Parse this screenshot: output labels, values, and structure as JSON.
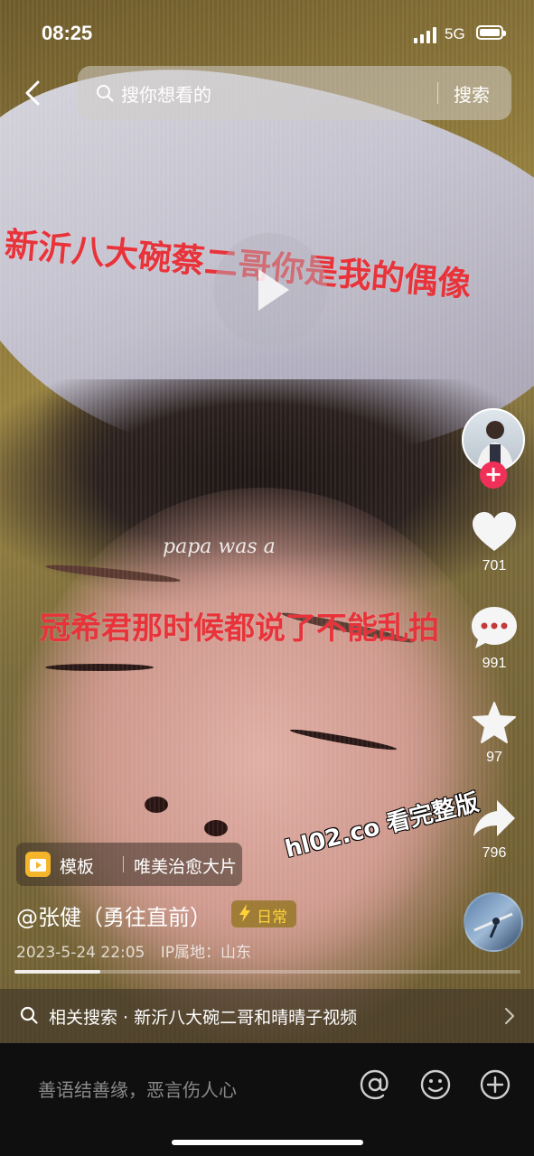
{
  "status_bar": {
    "time": "08:25",
    "network": "5G",
    "icons": [
      "signal-bars-icon",
      "battery-icon"
    ]
  },
  "header": {
    "back_icon": "chevron-left-icon",
    "search_placeholder": "搜你想看的",
    "search_button": "搜索"
  },
  "video": {
    "captions": [
      "新沂八大碗蔡二哥你是我的偶像",
      "冠希君那时候都说了不能乱拍"
    ],
    "watermark_text": "papa was a",
    "site_watermark": "hl02.co 看完整版",
    "play_icon": "play-icon"
  },
  "actions": {
    "like_count": "701",
    "comment_count": "991",
    "favorite_count": "97",
    "share_count": "796",
    "icons": [
      "heart-icon",
      "comment-bubble-icon",
      "star-icon",
      "share-arrow-icon"
    ],
    "follow_label": "+"
  },
  "post": {
    "template_label": "模板",
    "template_name": "唯美治愈大片",
    "author": "@张健（勇往直前）",
    "daily_badge": "日常",
    "date": "2023-5-24 22:05",
    "ip_location": "IP属地：山东",
    "progress_percent": 17
  },
  "related_search": {
    "text": "相关搜索 · 新沂八大碗二哥和晴晴子视频"
  },
  "comment_bar": {
    "placeholder": "善语结善缘，恶言伤人心",
    "icons": [
      "at-icon",
      "emoji-icon",
      "add-icon"
    ]
  },
  "colors": {
    "caption_red": "#e8333a",
    "follow_pink": "#f1305a",
    "badge_gold": "#ffd23a"
  }
}
